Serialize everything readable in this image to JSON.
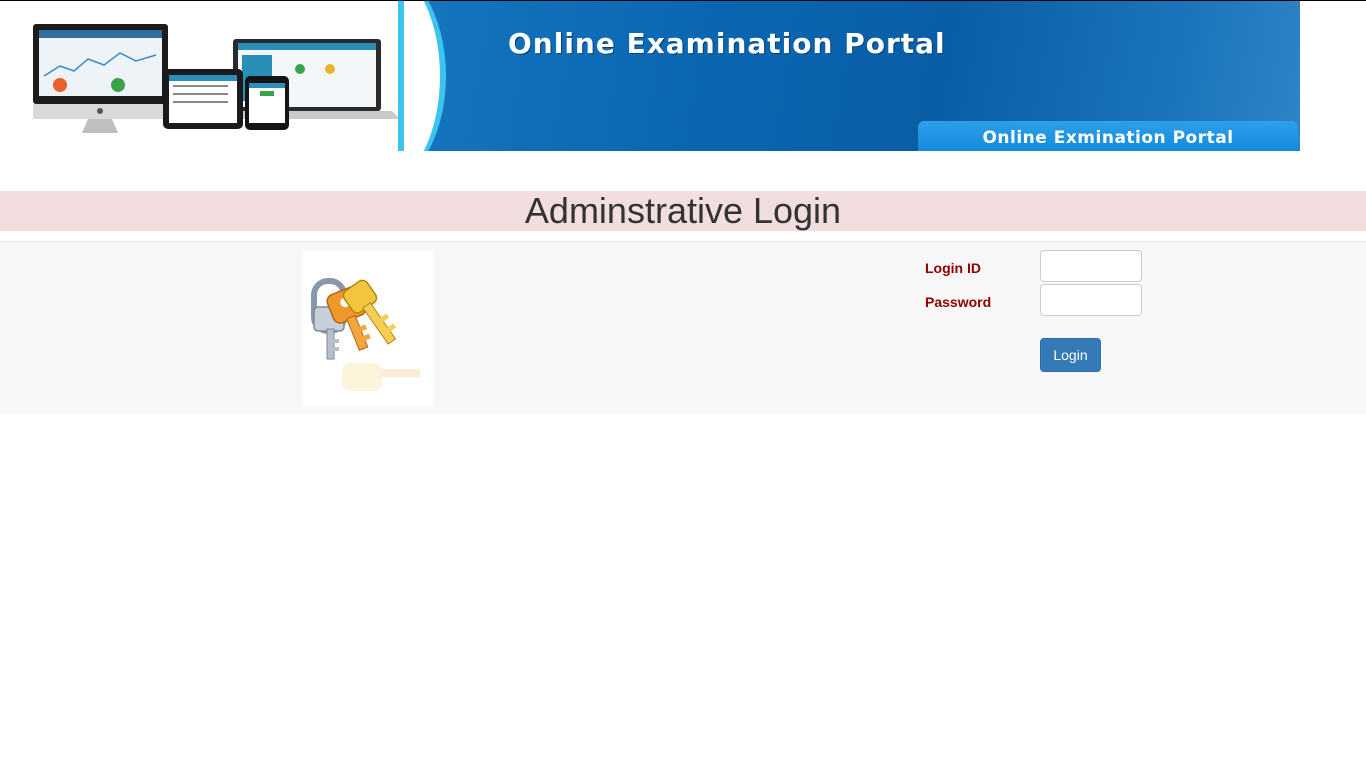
{
  "banner": {
    "title": "Online Examination Portal",
    "subtitle": "Online Exmination Portal",
    "accent": "#3cc4ee",
    "background": "#0a66b2"
  },
  "page": {
    "heading": "Adminstrative Login",
    "heading_bg": "#f2dede"
  },
  "form": {
    "login_id_label": "Login ID",
    "password_label": "Password",
    "login_id_value": "",
    "password_value": "",
    "submit_label": "Login",
    "label_color": "#8b0000",
    "button_color": "#337ab7"
  },
  "images": {
    "banner_devices": "devices-illustration",
    "keys": "keys-icon"
  }
}
